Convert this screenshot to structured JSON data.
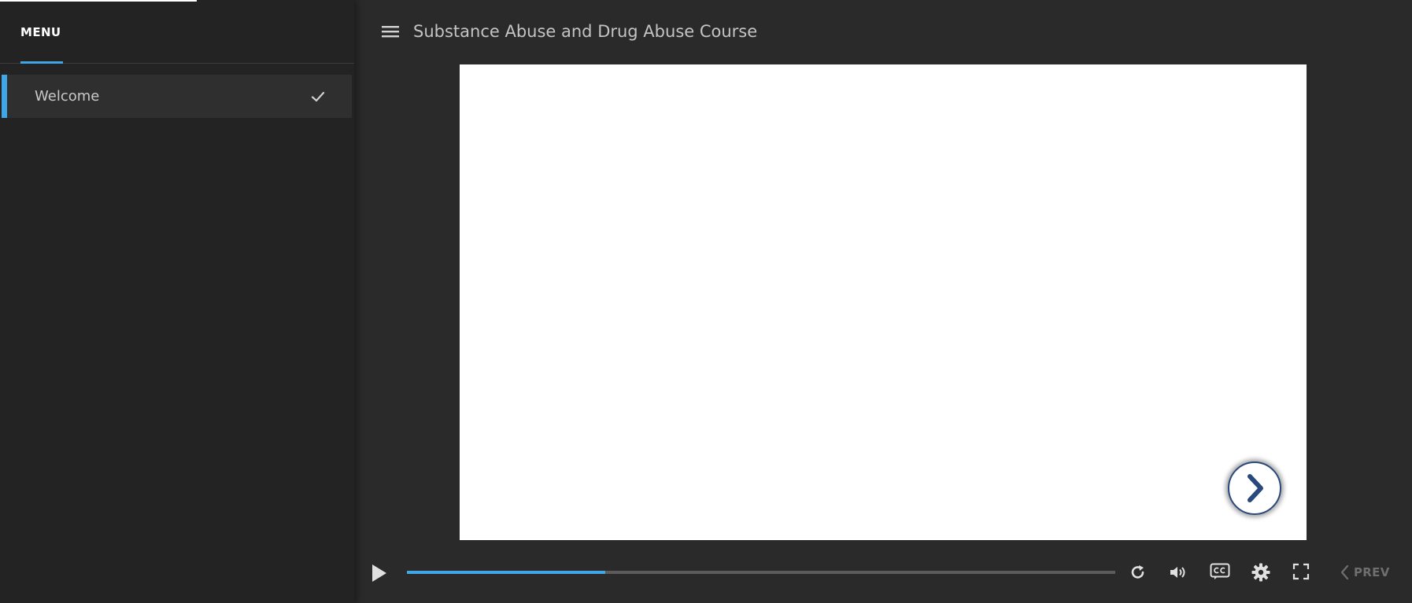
{
  "sidebar": {
    "tab_label": "MENU",
    "items": [
      {
        "label": "Welcome",
        "completed": true
      }
    ]
  },
  "header": {
    "title": "Substance Abuse and Drug Abuse Course"
  },
  "player": {
    "progress": 0.28,
    "prev_label": "PREV"
  },
  "colors": {
    "accent": "#41a6e6",
    "sidebar_bg": "#232323",
    "main_bg": "#2a2a2a",
    "next_button_border": "#29487d"
  },
  "icons": {
    "hamburger": "hamburger-icon",
    "check": "check-icon",
    "next": "chevron-right-icon",
    "play": "play-icon",
    "replay": "replay-icon",
    "volume": "volume-icon",
    "captions": "closed-captions-icon",
    "settings": "gear-icon",
    "fullscreen": "fullscreen-icon",
    "prev": "chevron-left-icon"
  }
}
